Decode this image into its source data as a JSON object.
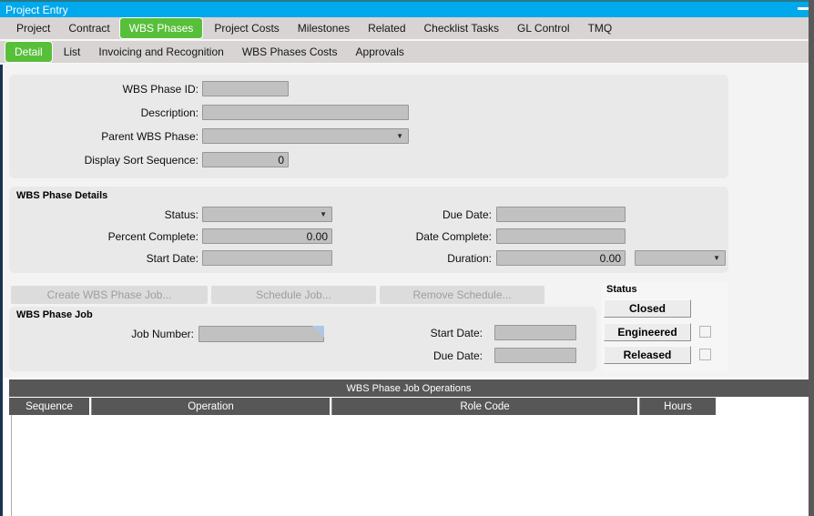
{
  "window": {
    "title": "Project Entry"
  },
  "tabs": {
    "primary": [
      {
        "label": "Project",
        "active": false
      },
      {
        "label": "Contract",
        "active": false
      },
      {
        "label": "WBS Phases",
        "active": true
      },
      {
        "label": "Project Costs",
        "active": false
      },
      {
        "label": "Milestones",
        "active": false
      },
      {
        "label": "Related",
        "active": false
      },
      {
        "label": "Checklist Tasks",
        "active": false
      },
      {
        "label": "GL Control",
        "active": false
      },
      {
        "label": "TMQ",
        "active": false
      }
    ],
    "secondary": [
      {
        "label": "Detail",
        "active": true
      },
      {
        "label": "List",
        "active": false
      },
      {
        "label": "Invoicing and Recognition",
        "active": false
      },
      {
        "label": "WBS Phases Costs",
        "active": false
      },
      {
        "label": "Approvals",
        "active": false
      }
    ]
  },
  "general": {
    "wbs_phase_id": {
      "label": "WBS Phase ID:",
      "value": ""
    },
    "description": {
      "label": "Description:",
      "value": ""
    },
    "parent_wbs_phase": {
      "label": "Parent WBS Phase:",
      "value": ""
    },
    "display_sort_sequence": {
      "label": "Display Sort Sequence:",
      "value": "0"
    }
  },
  "details": {
    "title": "WBS Phase Details",
    "status": {
      "label": "Status:",
      "value": ""
    },
    "percent_complete": {
      "label": "Percent Complete:",
      "value": "0.00"
    },
    "start_date": {
      "label": "Start Date:",
      "value": ""
    },
    "due_date": {
      "label": "Due Date:",
      "value": ""
    },
    "date_complete": {
      "label": "Date Complete:",
      "value": ""
    },
    "duration": {
      "label": "Duration:",
      "value": "0.00",
      "unit": ""
    }
  },
  "actions": {
    "create_job": "Create WBS Phase Job...",
    "schedule_job": "Schedule Job...",
    "remove_schedule": "Remove Schedule..."
  },
  "job": {
    "title": "WBS Phase Job",
    "job_number": {
      "label": "Job Number:",
      "value": ""
    },
    "start_date": {
      "label": "Start Date:",
      "value": ""
    },
    "due_date": {
      "label": "Due Date:",
      "value": ""
    }
  },
  "status_group": {
    "title": "Status",
    "closed": "Closed",
    "engineered": "Engineered",
    "released": "Released"
  },
  "operations": {
    "title": "WBS Phase Job Operations",
    "columns": [
      "Sequence",
      "Operation",
      "Role Code",
      "Hours"
    ],
    "rows": []
  },
  "colors": {
    "titlebar_blue": "#00a8ec",
    "active_tab_green": "#58bf3b",
    "table_header_gray": "#575757",
    "left_edge_navy": "#1c334f"
  }
}
